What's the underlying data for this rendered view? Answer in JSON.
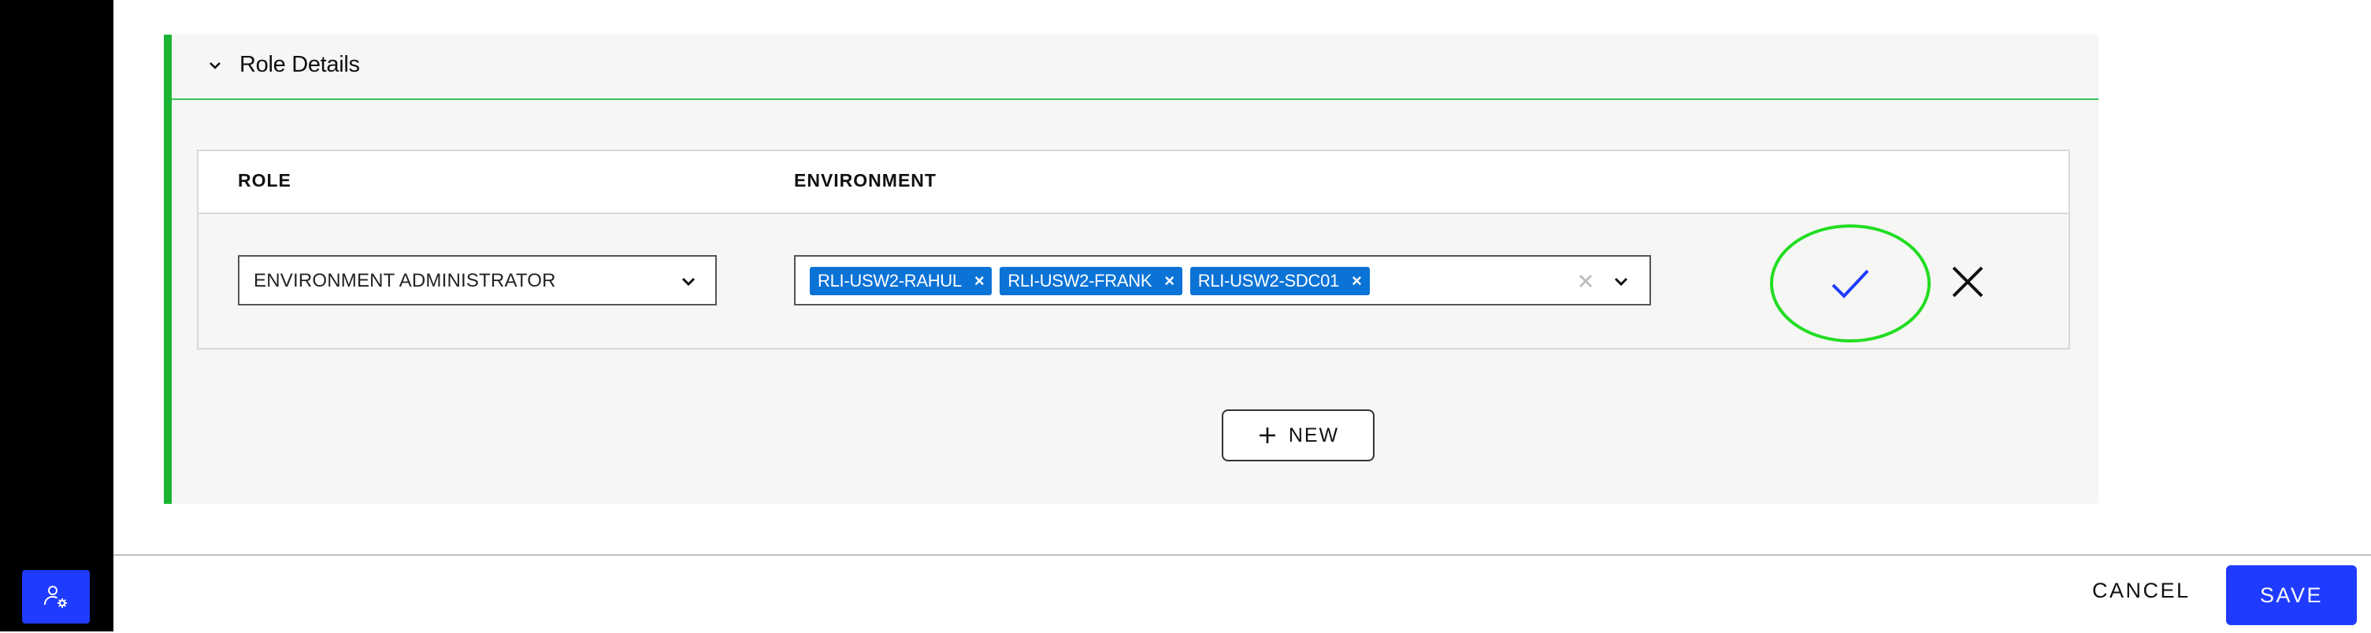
{
  "section": {
    "title": "Role Details",
    "accent_color": "#19b532"
  },
  "table": {
    "columns": [
      "ROLE",
      "ENVIRONMENT"
    ],
    "row": {
      "role_value": "ENVIRONMENT ADMINISTRATOR",
      "environments": [
        "RLI-USW2-RAHUL",
        "RLI-USW2-FRANK",
        "RLI-USW2-SDC01"
      ],
      "chip_color": "#0b73d6",
      "confirm_icon": "check-icon",
      "confirm_highlight_color": "#22dd22",
      "discard_icon": "close-icon"
    }
  },
  "new_button": {
    "label": "NEW",
    "icon": "plus-icon"
  },
  "footer": {
    "cancel_label": "CANCEL",
    "save_label": "SAVE",
    "primary_color": "#1f3bff"
  },
  "sidebar": {
    "icon": "user-settings-icon"
  }
}
